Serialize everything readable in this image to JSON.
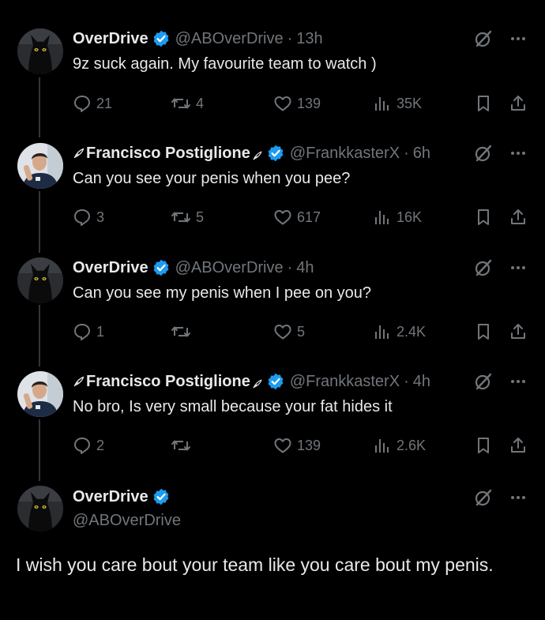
{
  "tweets": [
    {
      "name": "OverDrive",
      "handle": "@ABOverDrive",
      "time": "13h",
      "text": "9z suck again. My favourite team to watch )",
      "replies": "21",
      "retweets": "4",
      "likes": "139",
      "views": "35K"
    },
    {
      "name": "Francisco Postiglione",
      "handle": "@FrankkasterX",
      "time": "6h",
      "text": "Can you see your penis when you pee?",
      "replies": "3",
      "retweets": "5",
      "likes": "617",
      "views": "16K"
    },
    {
      "name": "OverDrive",
      "handle": "@ABOverDrive",
      "time": "4h",
      "text": "Can you see my penis when I pee on you?",
      "replies": "1",
      "retweets": "",
      "likes": "5",
      "views": "2.4K"
    },
    {
      "name": "Francisco Postiglione",
      "handle": "@FrankkasterX",
      "time": "4h",
      "text": "No bro, Is very small because your fat hides it",
      "replies": "2",
      "retweets": "",
      "likes": "139",
      "views": "2.6K"
    }
  ],
  "focused": {
    "name": "OverDrive",
    "handle": "@ABOverDrive",
    "text": "I wish you care bout your team like you care bout my penis."
  },
  "separator": "·",
  "icons": {
    "verified": "verified-badge-icon",
    "grok": "grok-icon",
    "more": "more-icon",
    "reply": "reply-icon",
    "retweet": "retweet-icon",
    "like": "like-icon",
    "views": "views-icon",
    "bookmark": "bookmark-icon",
    "share": "share-icon"
  },
  "colors": {
    "background": "#000000",
    "text": "#e7e9ea",
    "secondary": "#71767b",
    "verified": "#1d9bf0",
    "thread_line": "#333639"
  }
}
